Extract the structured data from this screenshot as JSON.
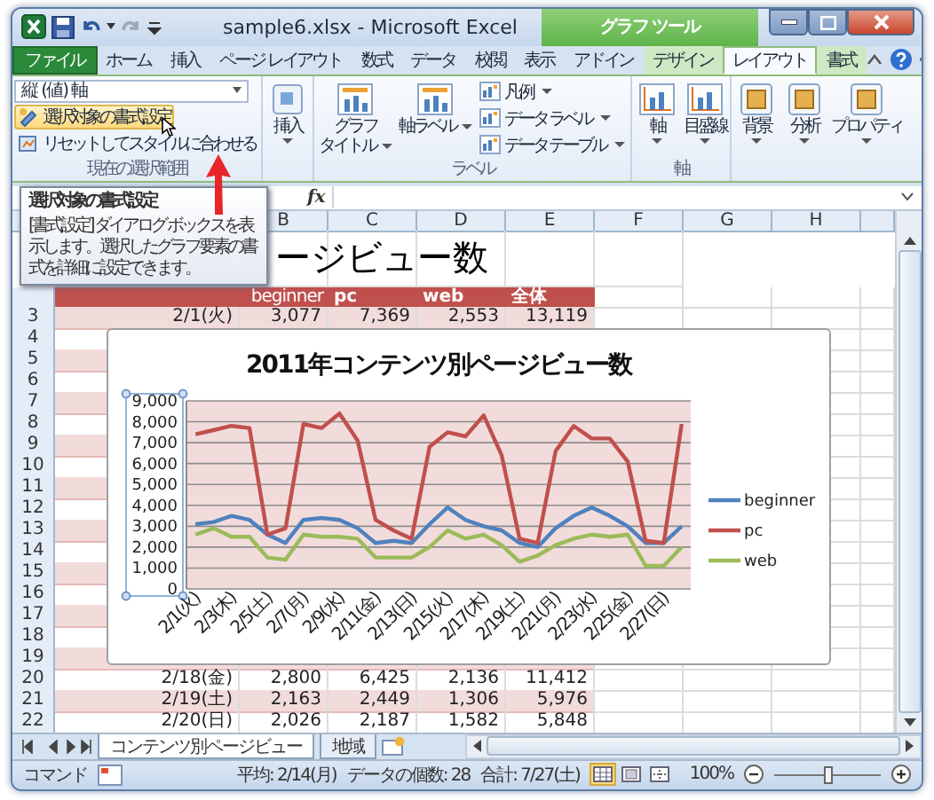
{
  "window": {
    "title": "sample6.xlsx - Microsoft Excel",
    "tool_group": "グラフ ツール"
  },
  "tabs": [
    {
      "label": "ファイル",
      "kind": "file",
      "selected": false
    },
    {
      "label": "ホーム",
      "kind": "main",
      "selected": false
    },
    {
      "label": "挿入",
      "kind": "main",
      "selected": false
    },
    {
      "label": "ページ レイアウト",
      "kind": "main",
      "selected": false
    },
    {
      "label": "数式",
      "kind": "main",
      "selected": false
    },
    {
      "label": "データ",
      "kind": "main",
      "selected": false
    },
    {
      "label": "校閲",
      "kind": "main",
      "selected": false
    },
    {
      "label": "表示",
      "kind": "main",
      "selected": false
    },
    {
      "label": "アドイン",
      "kind": "main",
      "selected": false
    },
    {
      "label": "デザイン",
      "kind": "tool",
      "selected": false
    },
    {
      "label": "レイアウト",
      "kind": "tool",
      "selected": true
    },
    {
      "label": "書式",
      "kind": "tool",
      "selected": false
    }
  ],
  "ribbon": {
    "selection": {
      "dropdown": "縦 (値) 軸",
      "format_button": "選択対象の書式設定",
      "format_hovered": true,
      "reset_button": "リセットしてスタイルに合わせる",
      "label": "現在の選択範囲"
    },
    "insert_button": "挿入",
    "labels": {
      "large_buttons": [
        [
          "グラフ",
          "タイトル"
        ],
        [
          "軸ラベル"
        ]
      ],
      "small_buttons": [
        "凡例",
        "データ ラベル",
        "データ テーブル"
      ],
      "label": "ラベル"
    },
    "axes": {
      "buttons": [
        "軸",
        "目盛線"
      ],
      "label": "軸"
    },
    "other_buttons": [
      "背景",
      "分析",
      "プロパティ"
    ]
  },
  "tooltip": {
    "title": "選択対象の書式設定",
    "body": "[書式設定] ダイアログ ボックスを表示します。選択したグラフ要素の書式を詳細に設定できます。"
  },
  "formula_bar": {
    "function_label": "fx"
  },
  "columns": [
    "B",
    "C",
    "D",
    "E",
    "F",
    "G",
    "H"
  ],
  "sheet": {
    "title_fragment": "ージビュー数",
    "header": [
      "beginner",
      "pc",
      "web",
      "全体"
    ],
    "rows": [
      {
        "number": "3",
        "shaded": true,
        "cells": [
          "2/1(火)",
          "3,077",
          "7,369",
          "2,553",
          "13,119"
        ]
      },
      {
        "number": "4",
        "shaded": false
      },
      {
        "number": "5",
        "shaded": true
      },
      {
        "number": "6",
        "shaded": false
      },
      {
        "number": "7",
        "shaded": true
      },
      {
        "number": "8",
        "shaded": false
      },
      {
        "number": "9",
        "shaded": true
      },
      {
        "number": "10",
        "shaded": false
      },
      {
        "number": "11",
        "shaded": true
      },
      {
        "number": "12",
        "shaded": false
      },
      {
        "number": "13",
        "shaded": true
      },
      {
        "number": "14",
        "shaded": false
      },
      {
        "number": "15",
        "shaded": true
      },
      {
        "number": "16",
        "shaded": false
      },
      {
        "number": "17",
        "shaded": true
      },
      {
        "number": "18",
        "shaded": false
      },
      {
        "number": "19",
        "shaded": true
      },
      {
        "number": "20",
        "shaded": false,
        "cells": [
          "2/18(金)",
          "2,800",
          "6,425",
          "2,136",
          "11,412"
        ]
      },
      {
        "number": "21",
        "shaded": true,
        "cells": [
          "2/19(土)",
          "2,163",
          "2,449",
          "1,306",
          "5,976"
        ]
      },
      {
        "number": "22",
        "shaded": false,
        "cells": [
          "2/20(日)",
          "2,026",
          "2,187",
          "1,582",
          "5,848"
        ]
      }
    ]
  },
  "chart": {
    "chart_data": {
      "type": "line",
      "title": "2011年コンテンツ別ページビュー数",
      "categories": [
        "2/1(火)",
        null,
        "2/3(木)",
        null,
        "2/5(土)",
        null,
        "2/7(月)",
        null,
        "2/9(水)",
        null,
        "2/11(金)",
        null,
        "2/13(日)",
        null,
        "2/15(火)",
        null,
        "2/17(木)",
        null,
        "2/19(土)",
        null,
        "2/21(月)",
        null,
        "2/23(水)",
        null,
        "2/25(金)",
        null,
        "2/27(日)",
        null
      ],
      "ylim": [
        0,
        9000
      ],
      "grid": true,
      "legend": true,
      "yticks": [
        {
          "value": 0,
          "label": "0"
        },
        {
          "value": 1000,
          "label": "1,000"
        },
        {
          "value": 2000,
          "label": "2,000"
        },
        {
          "value": 3000,
          "label": "3,000"
        },
        {
          "value": 4000,
          "label": "4,000"
        },
        {
          "value": 5000,
          "label": "5,000"
        },
        {
          "value": 6000,
          "label": "6,000"
        },
        {
          "value": 7000,
          "label": "7,000"
        },
        {
          "value": 8000,
          "label": "8,000"
        },
        {
          "value": 9000,
          "label": "9,000"
        }
      ],
      "series": [
        {
          "name": "beginner",
          "color": "#4f81bd",
          "values": [
            3100,
            3200,
            3500,
            3300,
            2600,
            2200,
            3300,
            3400,
            3300,
            2900,
            2200,
            2300,
            2200,
            3100,
            3900,
            3300,
            3000,
            2800,
            2200,
            2000,
            2900,
            3500,
            3900,
            3500,
            3000,
            2200,
            2200,
            3000
          ]
        },
        {
          "name": "pc",
          "color": "#c0504d",
          "values": [
            7400,
            7600,
            7800,
            7700,
            2600,
            2900,
            7900,
            7700,
            8400,
            7100,
            3300,
            2800,
            2400,
            6800,
            7500,
            7300,
            8300,
            6400,
            2400,
            2200,
            6600,
            7800,
            7200,
            7200,
            6100,
            2300,
            2200,
            7900
          ]
        },
        {
          "name": "web",
          "color": "#9bbb59",
          "values": [
            2600,
            2900,
            2500,
            2500,
            1500,
            1400,
            2600,
            2500,
            2500,
            2400,
            1500,
            1500,
            1500,
            2000,
            2800,
            2400,
            2600,
            2100,
            1300,
            1600,
            2100,
            2400,
            2600,
            2500,
            2600,
            1100,
            1100,
            2000
          ]
        }
      ]
    }
  },
  "sheet_tabs": [
    {
      "label": "コンテンツ別ページビュー",
      "selected": true
    },
    {
      "label": "地域",
      "selected": false
    }
  ],
  "status_bar": {
    "mode": "コマンド",
    "average": "平均: 2/14(月)",
    "count": "データの個数: 28",
    "sum": "合計: 7/27(土)",
    "views": [
      {
        "kind": "normal",
        "selected": true
      },
      {
        "kind": "page_layout",
        "selected": false
      },
      {
        "kind": "page_break",
        "selected": false
      }
    ],
    "zoom": "100%",
    "zoom_slider": {
      "level": 0.5
    }
  }
}
